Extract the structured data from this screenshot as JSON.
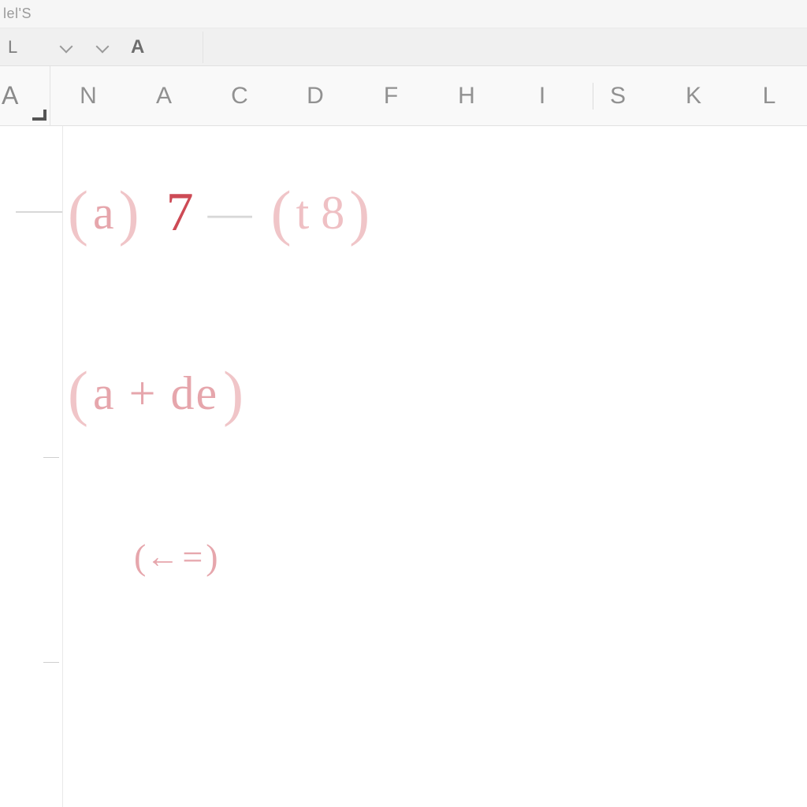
{
  "titlebar": {
    "text": "lel'S"
  },
  "toolbar": {
    "tool_label": "L",
    "font_glyph": "A"
  },
  "ruler": {
    "corner_label": "A",
    "columns": [
      "N",
      "A",
      "C",
      "D",
      "F",
      "H",
      "I",
      "S",
      "K",
      "L"
    ]
  },
  "equations": {
    "line1": {
      "open1": "(",
      "sub1": ",",
      "a": "a",
      "close1": ")",
      "seven": "7",
      "minus": "—",
      "open2": "(",
      "sub2": ",",
      "t8": "t 8",
      "close2": ")"
    },
    "line2": {
      "open": "(",
      "sub": ",",
      "body": "a + de",
      "close": ")"
    },
    "line3": {
      "open": "(",
      "arrow": "←",
      "eq": "=",
      "close": ")"
    }
  }
}
